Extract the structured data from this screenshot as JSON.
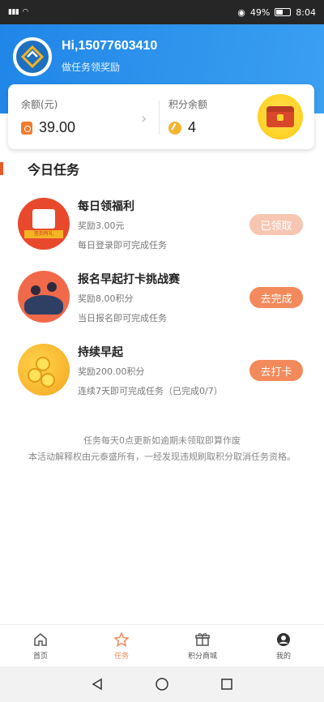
{
  "status_bar": {
    "left": "4G 4G",
    "battery": "49%",
    "time": "8:04"
  },
  "header": {
    "greeting": "Hi,15077603410",
    "subtitle": "做任务领奖励"
  },
  "balance": {
    "balance_label": "余额(元)",
    "balance_value": "39.00",
    "points_label": "积分余额",
    "points_value": "4"
  },
  "section": {
    "title": "今日任务"
  },
  "tasks": [
    {
      "title": "每日领福利",
      "reward": "奖励3.00元",
      "desc": "每日登录即可完成任务",
      "button": "已领取",
      "icon_band": "签到有礼"
    },
    {
      "title": "报名早起打卡挑战赛",
      "reward": "奖励8.00积分",
      "desc": "当日报名即可完成任务",
      "button": "去完成"
    },
    {
      "title": "持续早起",
      "reward": "奖励200.00积分",
      "desc": "连续7天即可完成任务（已完成0/7）",
      "button": "去打卡"
    }
  ],
  "notes": [
    "任务每天0点更新如逾期未领取即算作废",
    "本活动解释权由元泰盛所有，一经发现违规刷取积分取消任务资格。"
  ],
  "tabbar": {
    "items": [
      {
        "label": "首页",
        "icon": "home-icon"
      },
      {
        "label": "任务",
        "icon": "star-icon"
      },
      {
        "label": "积分商城",
        "icon": "gift-icon"
      },
      {
        "label": "我的",
        "icon": "user-icon"
      }
    ],
    "active_color": "#f28a5b"
  },
  "colors": {
    "header_blue": "#2a91ec",
    "accent_orange": "#f28a5b"
  }
}
